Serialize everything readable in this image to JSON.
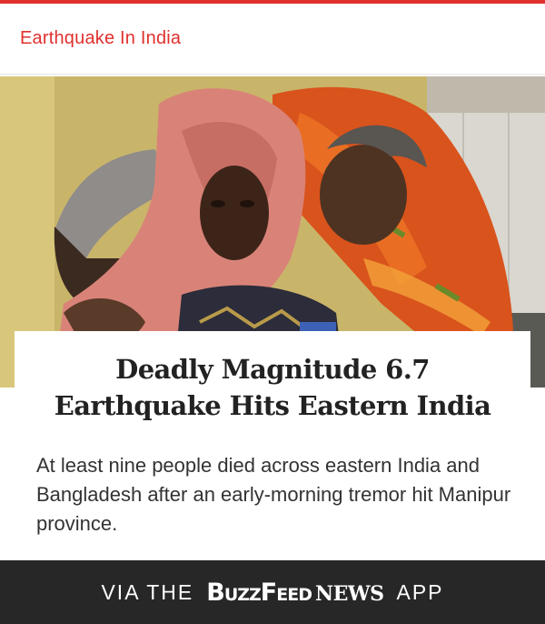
{
  "header": {
    "section_title": "Earthquake In India",
    "accent_color": "#e0302e"
  },
  "photo": {
    "icon": "news-photo",
    "subject": "people-wrapped-in-shawls"
  },
  "article": {
    "headline_line1": "Deadly Magnitude 6.7",
    "headline_line2": "Earthquake Hits Eastern India",
    "summary": "At least nine people died across eastern India and Bangladesh after an early-morning tremor hit Manipur province."
  },
  "footer": {
    "via_label": "VIA THE",
    "logo_buzz": "BuzzFeed",
    "logo_news": "NEWS",
    "app_label": "APP",
    "background_color": "#272727"
  }
}
